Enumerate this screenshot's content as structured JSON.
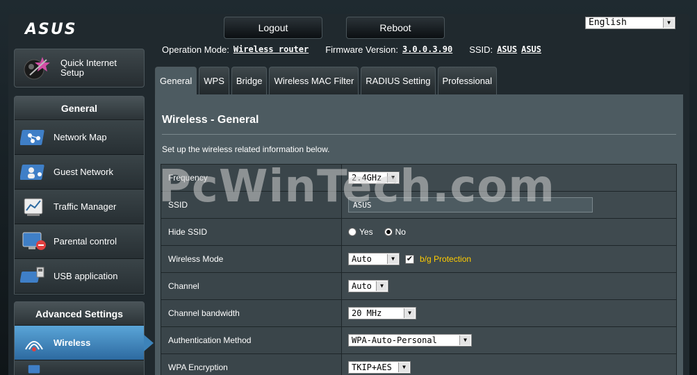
{
  "header": {
    "logo_text": "ASUS",
    "logout_label": "Logout",
    "reboot_label": "Reboot",
    "language": "English"
  },
  "infobar": {
    "op_mode_label": "Operation Mode:",
    "op_mode_value": "Wireless router",
    "firmware_label": "Firmware Version:",
    "firmware_value": "3.0.0.3.90",
    "ssid_label": "SSID:",
    "ssid_value_1": "ASUS",
    "ssid_value_2": "ASUS"
  },
  "sidebar": {
    "quick_setup_line1": "Quick Internet",
    "quick_setup_line2": "Setup",
    "general_header": "General",
    "general_items": [
      {
        "label": "Network Map",
        "icon": "network-map-icon"
      },
      {
        "label": "Guest Network",
        "icon": "guest-network-icon"
      },
      {
        "label": "Traffic Manager",
        "icon": "traffic-manager-icon"
      },
      {
        "label": "Parental control",
        "icon": "parental-control-icon"
      },
      {
        "label": "USB application",
        "icon": "usb-application-icon"
      }
    ],
    "advanced_header": "Advanced Settings",
    "advanced_items": [
      {
        "label": "Wireless",
        "icon": "wireless-icon",
        "active": true
      }
    ]
  },
  "tabs": [
    {
      "label": "General",
      "active": true
    },
    {
      "label": "WPS"
    },
    {
      "label": "Bridge"
    },
    {
      "label": "Wireless MAC Filter"
    },
    {
      "label": "RADIUS Setting"
    },
    {
      "label": "Professional"
    }
  ],
  "content": {
    "title": "Wireless - General",
    "description": "Set up the wireless related information below.",
    "watermark": "PcWinTech.com",
    "rows": {
      "frequency": {
        "label": "Frequency",
        "value": "2.4GHz"
      },
      "ssid": {
        "label": "SSID",
        "value": "ASUS"
      },
      "hide_ssid": {
        "label": "Hide SSID",
        "yes": "Yes",
        "no": "No",
        "selected": "No"
      },
      "wireless_mode": {
        "label": "Wireless Mode",
        "value": "Auto",
        "protection_label": "b/g Protection",
        "protection_checked": true
      },
      "channel": {
        "label": "Channel",
        "value": "Auto"
      },
      "bandwidth": {
        "label": "Channel bandwidth",
        "value": "20 MHz"
      },
      "auth": {
        "label": "Authentication Method",
        "value": "WPA-Auto-Personal"
      },
      "wpa_enc": {
        "label": "WPA Encryption",
        "value": "TKIP+AES"
      }
    }
  },
  "colors": {
    "accent": "#3d83b9",
    "content_bg": "#4d5b61",
    "highlight_text": "#ffcc00"
  }
}
